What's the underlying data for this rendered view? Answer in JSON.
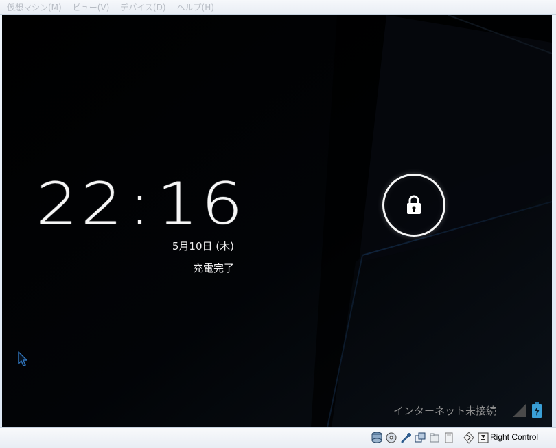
{
  "menubar": {
    "items": [
      "仮想マシン(M)",
      "ビュー(V)",
      "デバイス(D)",
      "ヘルプ(H)"
    ]
  },
  "lockscreen": {
    "time_hours": "22",
    "time_separator": ":",
    "time_minutes": "16",
    "date": "5月10日 (木)",
    "charging_status": "充電完了",
    "network_status": "インターネット未接続"
  },
  "vbox_status": {
    "host_key_label": "Right Control",
    "icons": [
      "hard-disk-icon",
      "optical-drive-icon",
      "usb-icon",
      "network-icon",
      "shared-folders-icon",
      "display-icon",
      "mouse-integration-icon",
      "host-key-icon"
    ]
  },
  "colors": {
    "screen_background": "#000000",
    "clock_text": "#f6f6f6",
    "status_text": "#8e8e8e",
    "battery_accent": "#3a9fd6"
  }
}
